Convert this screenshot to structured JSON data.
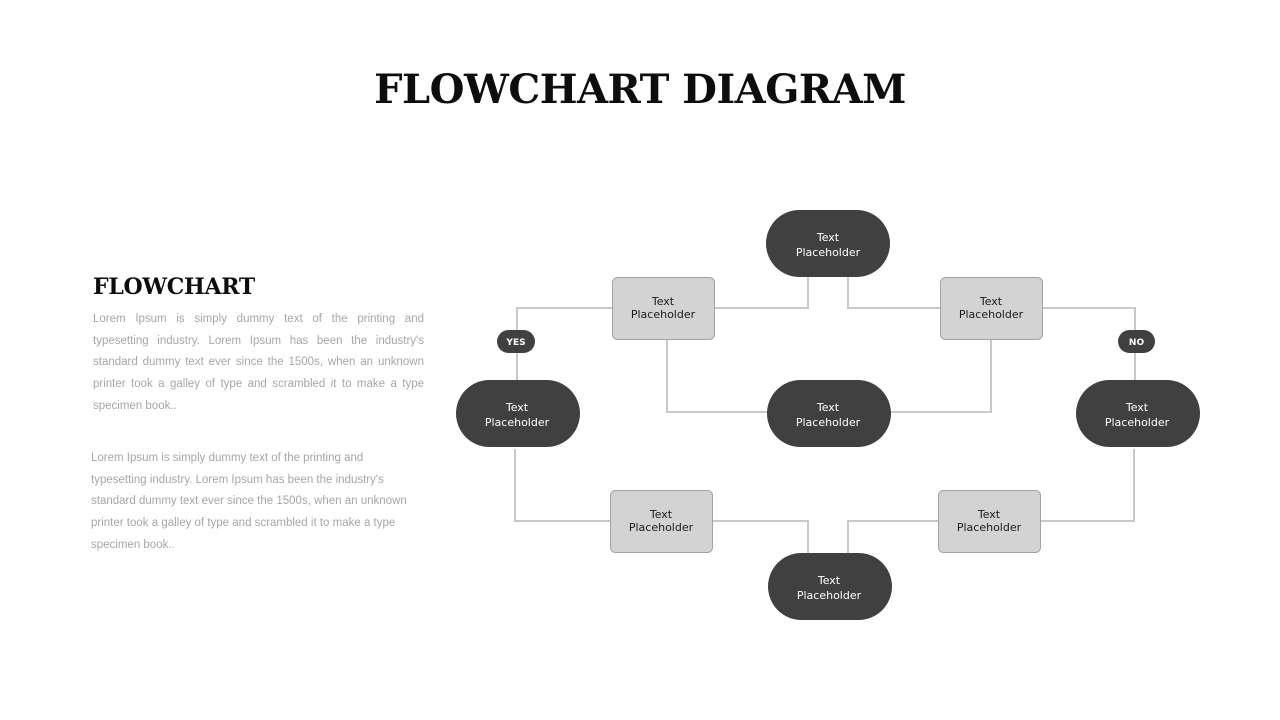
{
  "title": "FLOWCHART DIAGRAM",
  "sidebar": {
    "heading": "FLOWCHART",
    "paragraphs": [
      "Lorem Ipsum is simply dummy text of the printing and typesetting industry. Lorem Ipsum has been the industry's standard dummy text ever since the 1500s, when an unknown printer took a galley of type and scrambled it to make a type specimen book..",
      "Lorem Ipsum is simply dummy text of the printing and typesetting industry. Lorem Ipsum has been the industry's standard dummy text ever since the 1500s, when an unknown printer took a galley of type and scrambled it to make a type specimen book.."
    ]
  },
  "colors": {
    "terminal_fill": "#404040",
    "process_fill": "#d3d3d3",
    "process_border": "#a3a3a3",
    "connector": "#c8c8c8",
    "heading_text": "#0d0d0d",
    "body_text": "#a6a6a6"
  },
  "flowchart": {
    "nodes": [
      {
        "id": "top",
        "shape": "terminal",
        "lines": [
          "Text",
          "Placeholder"
        ]
      },
      {
        "id": "upper-left",
        "shape": "process",
        "lines": [
          "Text",
          "Placeholder"
        ]
      },
      {
        "id": "upper-right",
        "shape": "process",
        "lines": [
          "Text",
          "Placeholder"
        ]
      },
      {
        "id": "left",
        "shape": "terminal",
        "lines": [
          "Text",
          "Placeholder"
        ]
      },
      {
        "id": "center",
        "shape": "terminal",
        "lines": [
          "Text",
          "Placeholder"
        ]
      },
      {
        "id": "right",
        "shape": "terminal",
        "lines": [
          "Text",
          "Placeholder"
        ]
      },
      {
        "id": "lower-left",
        "shape": "process",
        "lines": [
          "Text",
          "Placeholder"
        ]
      },
      {
        "id": "lower-right",
        "shape": "process",
        "lines": [
          "Text",
          "Placeholder"
        ]
      },
      {
        "id": "bottom",
        "shape": "terminal",
        "lines": [
          "Text",
          "Placeholder"
        ]
      }
    ],
    "edges": [
      {
        "from": "top",
        "to": "upper-left"
      },
      {
        "from": "top",
        "to": "upper-right"
      },
      {
        "from": "upper-left",
        "to": "left",
        "label": "YES"
      },
      {
        "from": "upper-right",
        "to": "right",
        "label": "NO"
      },
      {
        "from": "upper-left",
        "to": "center"
      },
      {
        "from": "upper-right",
        "to": "center"
      },
      {
        "from": "left",
        "to": "lower-left"
      },
      {
        "from": "right",
        "to": "lower-right"
      },
      {
        "from": "lower-left",
        "to": "bottom"
      },
      {
        "from": "lower-right",
        "to": "bottom"
      }
    ],
    "badges": [
      {
        "id": "yes",
        "label": "YES"
      },
      {
        "id": "no",
        "label": "NO"
      }
    ]
  }
}
